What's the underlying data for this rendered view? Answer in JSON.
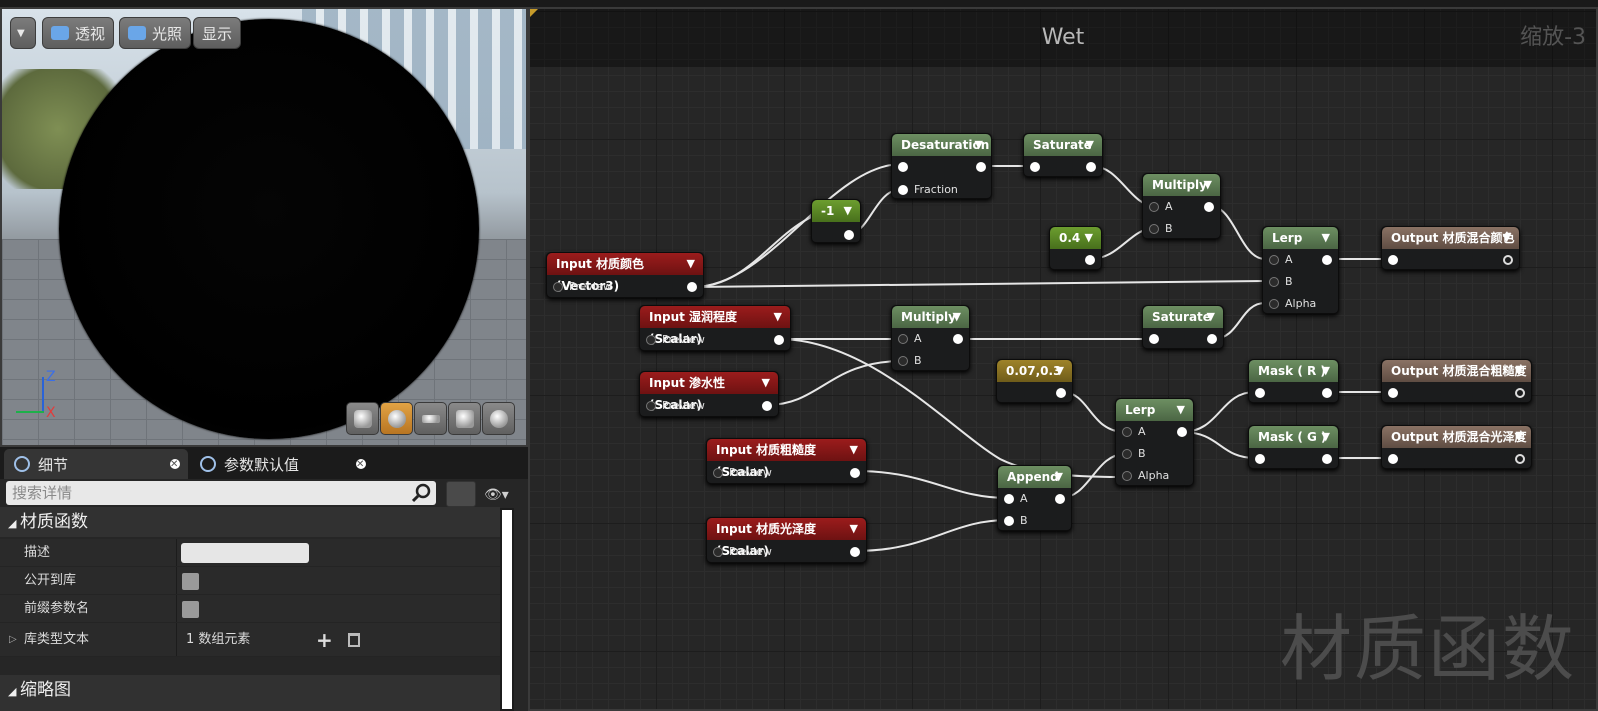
{
  "viewport": {
    "menu_icon": "chevron-down-icon",
    "buttons": {
      "perspective": "透视",
      "lighting": "光照",
      "show": "显示"
    },
    "axis": {
      "z": "Z",
      "x": "X"
    },
    "preview_shapes": [
      "cylinder-icon",
      "sphere-icon",
      "plane-icon",
      "cube-icon",
      "teapot-icon"
    ]
  },
  "details": {
    "tabs": [
      {
        "label": "细节"
      },
      {
        "label": "参数默认值"
      }
    ],
    "search_placeholder": "搜索详情",
    "section1": "材质函数",
    "rows": {
      "description": "描述",
      "expose_to_library": "公开到库",
      "prefix_param_names": "前缀参数名",
      "library_category_text": "库类型文本",
      "array_elements": "1 数组元素"
    },
    "section2": "缩略图"
  },
  "graph": {
    "title": "Wet",
    "zoom": "缩放-3",
    "watermark": "材质函数",
    "nodes": {
      "input_color": {
        "title": "Input 材质颜色 (Vector3)",
        "pin": "Preview"
      },
      "input_wetness": {
        "title": "Input 湿润程度 (Scalar)",
        "pin": "Preview"
      },
      "input_absorb": {
        "title": "Input 渗水性 (Scalar)",
        "pin": "Preview"
      },
      "input_rough": {
        "title": "Input 材质粗糙度 (Scalar)",
        "pin": "Preview"
      },
      "input_gloss": {
        "title": "Input 材质光泽度 (Scalar)",
        "pin": "Preview"
      },
      "neg1": {
        "title": "-1"
      },
      "desat": {
        "title": "Desaturation",
        "pin2": "Fraction"
      },
      "sat1": {
        "title": "Saturate"
      },
      "const04": {
        "title": "0.4"
      },
      "mul1": {
        "title": "Multiply",
        "a": "A",
        "b": "B"
      },
      "lerp1": {
        "title": "Lerp",
        "a": "A",
        "b": "B",
        "alpha": "Alpha"
      },
      "out_color": {
        "title": "Output 材质混合颜色"
      },
      "mul2": {
        "title": "Multiply",
        "a": "A",
        "b": "B"
      },
      "sat2": {
        "title": "Saturate"
      },
      "const2": {
        "title": "0.07,0.3"
      },
      "lerp2": {
        "title": "Lerp",
        "a": "A",
        "b": "B",
        "alpha": "Alpha"
      },
      "append": {
        "title": "Append",
        "a": "A",
        "b": "B"
      },
      "mask_r": {
        "title": "Mask ( R )"
      },
      "mask_g": {
        "title": "Mask ( G )"
      },
      "out_rough": {
        "title": "Output 材质混合粗糙度"
      },
      "out_gloss": {
        "title": "Output 材质混合光泽度"
      }
    }
  }
}
